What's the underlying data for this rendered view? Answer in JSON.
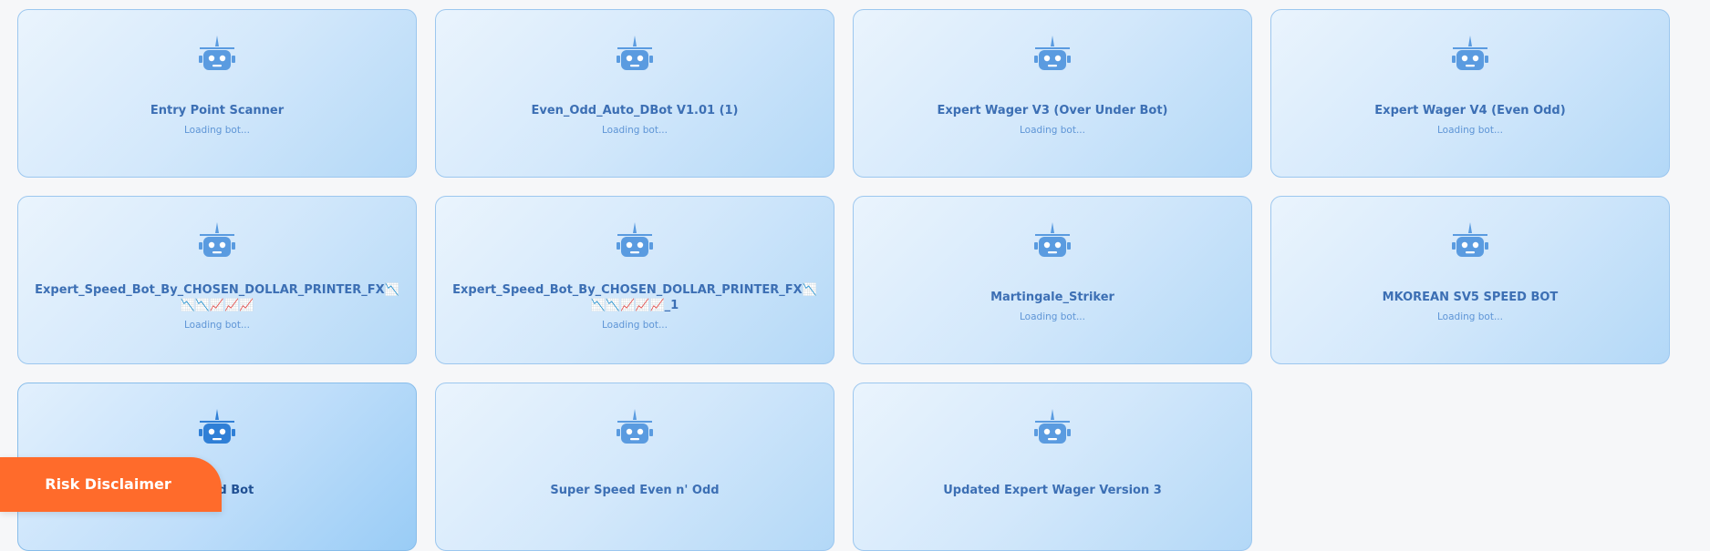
{
  "colors": {
    "card_border": "#9cc7ef",
    "card_title": "#3c6fb4",
    "card_status": "#5e95d6",
    "robot_icon": "#5a9be0",
    "robot_icon_active": "#2f7fd6",
    "disclaimer_bg": "#ff6b2b"
  },
  "bots": [
    {
      "name": "Entry Point Scanner",
      "status": "Loading bot...",
      "icon": "robot-icon"
    },
    {
      "name": "Even_Odd_Auto_DBot V1.01 (1)",
      "status": "Loading bot...",
      "icon": "robot-icon"
    },
    {
      "name": "Expert Wager V3 (Over Under Bot)",
      "status": "Loading bot...",
      "icon": "robot-icon"
    },
    {
      "name": "Expert Wager V4 (Even Odd)",
      "status": "Loading bot...",
      "icon": "robot-icon"
    },
    {
      "name": "Expert_Speed_Bot_By_CHOSEN_DOLLAR_PRINTER_FX📉📉📉📈📈📈",
      "status": "Loading bot...",
      "icon": "robot-icon"
    },
    {
      "name": "Expert_Speed_Bot_By_CHOSEN_DOLLAR_PRINTER_FX📉📉📉📈📈📈_1",
      "status": "Loading bot...",
      "icon": "robot-icon"
    },
    {
      "name": "Martingale_Striker",
      "status": "Loading bot...",
      "icon": "robot-icon"
    },
    {
      "name": "MKOREAN SV5 SPEED BOT",
      "status": "Loading bot...",
      "icon": "robot-icon"
    },
    {
      "name": "...peed Bot",
      "status": "",
      "icon": "robot-icon"
    },
    {
      "name": "Super Speed Even n' Odd",
      "status": "",
      "icon": "robot-icon"
    },
    {
      "name": "Updated Expert Wager Version 3",
      "status": "",
      "icon": "robot-icon"
    }
  ],
  "disclaimer": {
    "label": "Risk Disclaimer"
  }
}
